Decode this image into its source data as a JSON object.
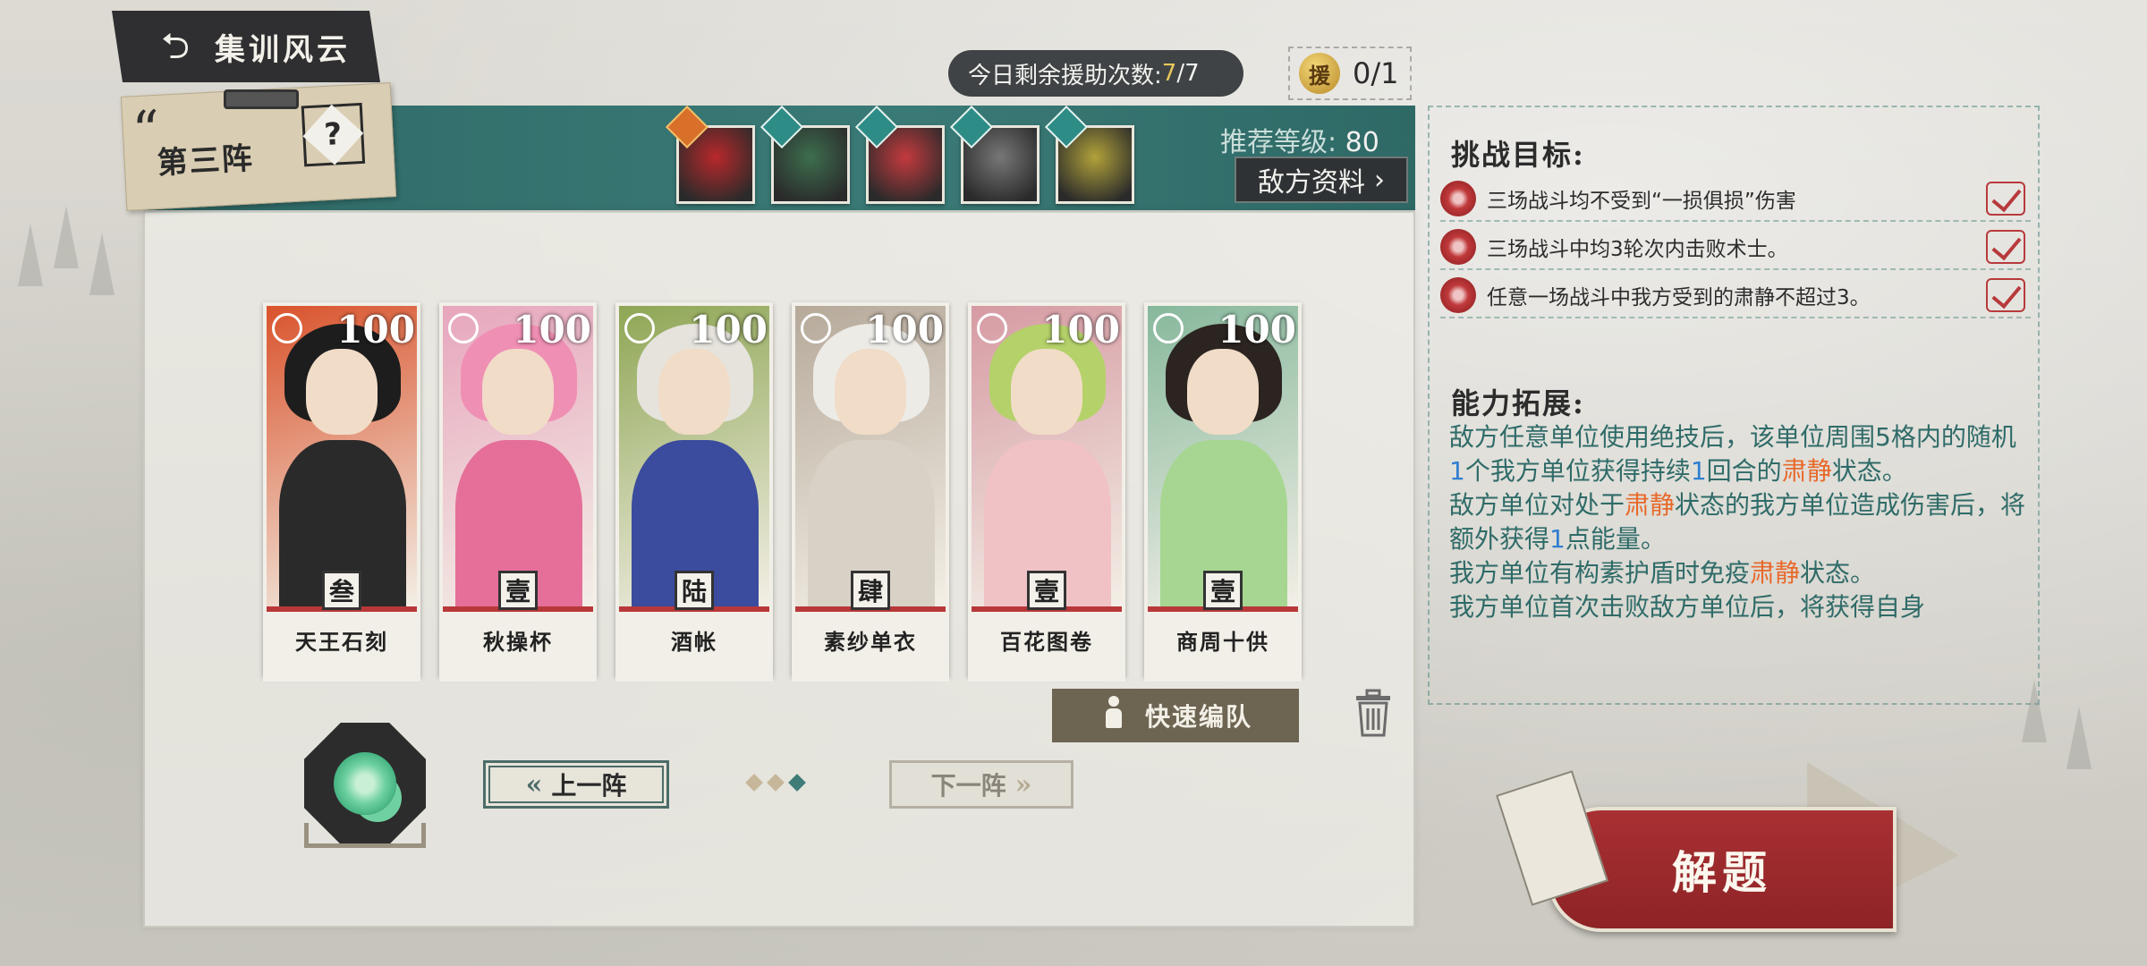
{
  "header": {
    "back_title": "集训风云"
  },
  "assist": {
    "label": "今日剩余援助次数: ",
    "current": "7",
    "total": "/7",
    "icon_glyph": "援",
    "count": "0/1"
  },
  "formation": {
    "label": "第三阵",
    "unknown_glyph": "?"
  },
  "enemies": [
    {
      "name": "boss-enemy",
      "boss": true,
      "color": "#b8282b"
    },
    {
      "name": "enemy-2",
      "boss": false,
      "color": "#3d6e4e"
    },
    {
      "name": "enemy-3",
      "boss": false,
      "color": "#c33a3e"
    },
    {
      "name": "enemy-4",
      "boss": false,
      "color": "#777777"
    },
    {
      "name": "enemy-5",
      "boss": false,
      "color": "#b1a23a"
    }
  ],
  "recommend": {
    "label": "推荐等级: ",
    "level": "80"
  },
  "enemy_info_button": "敌方资料",
  "units": [
    {
      "name": "天王石刻",
      "level": "100",
      "tier": "叁",
      "art_bg": "#d9532c",
      "hair": "#1d1d1d",
      "body": "#2a2a2a"
    },
    {
      "name": "秋操杯",
      "level": "100",
      "tier": "壹",
      "art_bg": "#e7a6bd",
      "hair": "#f08fb4",
      "body": "#e56f99"
    },
    {
      "name": "酒帐",
      "level": "100",
      "tier": "陆",
      "art_bg": "#8ea654",
      "hair": "#e5e3dc",
      "body": "#3b4b9d"
    },
    {
      "name": "素纱单衣",
      "level": "100",
      "tier": "肆",
      "art_bg": "#b6a99a",
      "hair": "#ecebe6",
      "body": "#d8d2c6"
    },
    {
      "name": "百花图卷",
      "level": "100",
      "tier": "壹",
      "art_bg": "#d69aa3",
      "hair": "#b5d16a",
      "body": "#f0c2c6"
    },
    {
      "name": "商周十供",
      "level": "100",
      "tier": "壹",
      "art_bg": "#86b89c",
      "hair": "#2b2420",
      "body": "#a6d691"
    }
  ],
  "quick_formation": "快速编队",
  "pager": {
    "prev": "上一阵",
    "next": "下一阵"
  },
  "objectives": {
    "title": "挑战目标:",
    "items": [
      "三场战斗均不受到“一损俱损”伤害",
      "三场战斗中均3轮次内击败术士。",
      "任意一场战斗中我方受到的肃静不超过3。"
    ]
  },
  "ability": {
    "title": "能力拓展:",
    "p1_a": "敌方任意单位使用绝技后，该单位周围5格内的随机",
    "p1_n1": "1",
    "p1_b": "个我方单位获得持续",
    "p1_n2": "1",
    "p1_c": "回合的",
    "p1_kw": "肃静",
    "p1_d": "状态。",
    "p2_a": "敌方单位对处于",
    "p2_kw": "肃静",
    "p2_b": "状态的我方单位造成伤害后，将额外获得",
    "p2_n": "1",
    "p2_c": "点能量。",
    "p3_a": "我方单位有构素护盾时免疫",
    "p3_kw": "肃静",
    "p3_b": "状态。",
    "p4": "我方单位首次击败敌方单位后，将获得自身"
  },
  "solve_button": "解题"
}
